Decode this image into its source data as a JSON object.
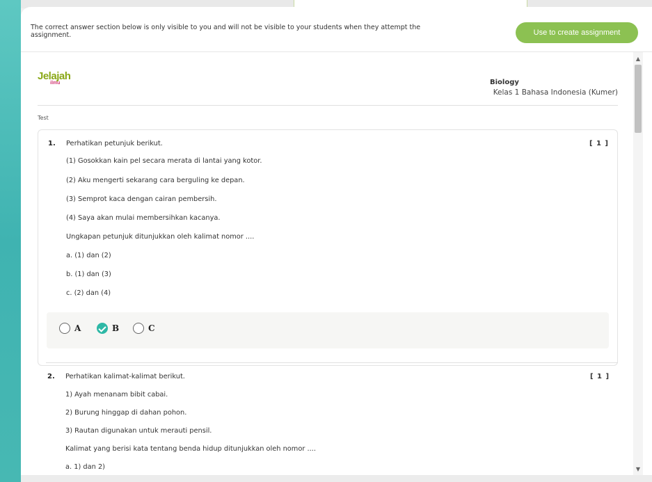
{
  "notice": "The correct answer section below is only visible to you and will not be visible to your students when they attempt the assignment.",
  "cta_label": "Use to create assignment",
  "header": {
    "logo_text": "Jelajah",
    "logo_sub": "ilmu",
    "subject": "Biology",
    "class_name": "Kelas 1 Bahasa Indonesia (Kumer)"
  },
  "section_label": "Test",
  "questions": [
    {
      "number": "1.",
      "marks": "[ 1 ]",
      "lines": [
        "Perhatikan petunjuk berikut.",
        "(1) Gosokkan kain pel secara merata di lantai yang kotor.",
        "(2) Aku mengerti sekarang cara berguling ke depan.",
        "(3) Semprot kaca dengan cairan pembersih.",
        "(4) Saya akan mulai membersihkan kacanya.",
        "Ungkapan petunjuk ditunjukkan oleh kalimat nomor ....",
        "a. (1) dan (2)",
        "b. (1) dan (3)",
        "c. (2) dan (4)"
      ],
      "options": [
        {
          "label": "A",
          "checked": false
        },
        {
          "label": "B",
          "checked": true
        },
        {
          "label": "C",
          "checked": false
        }
      ]
    },
    {
      "number": "2.",
      "marks": "[ 1 ]",
      "lines": [
        "Perhatikan kalimat-kalimat berikut.",
        "1) Ayah menanam bibit cabai.",
        "2) Burung hinggap di dahan pohon.",
        "3) Rautan digunakan untuk merauti pensil.",
        "Kalimat yang berisi kata tentang benda hidup ditunjukkan oleh nomor ....",
        "a. 1) dan 2)"
      ]
    }
  ],
  "colors": {
    "accent_green": "#8cc152",
    "check_teal": "#2eb8a6",
    "sidebar_teal": "#3fb3b1"
  },
  "icons": {
    "scroll_up": "triangle-up",
    "scroll_down": "triangle-down",
    "checked_radio": "check-circle"
  }
}
